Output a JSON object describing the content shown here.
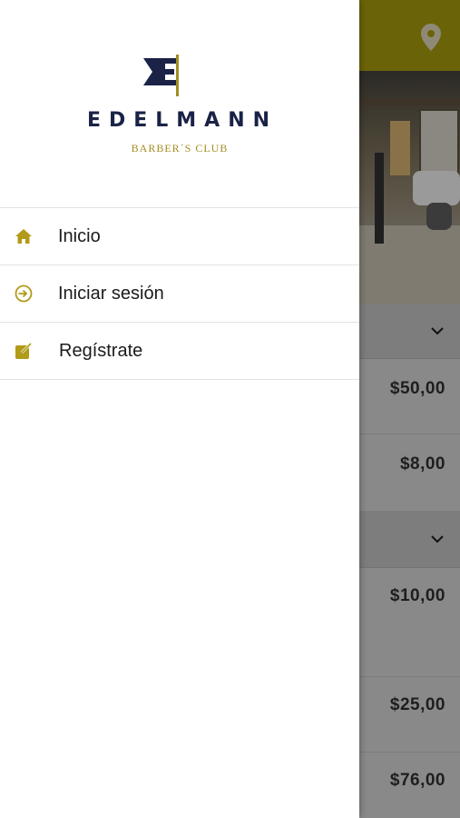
{
  "brand": {
    "name": "EDELMANN",
    "subtitle": "BARBER´S CLUB"
  },
  "drawer": {
    "items": [
      {
        "label": "Inicio",
        "icon": "home-icon"
      },
      {
        "label": "Iniciar sesión",
        "icon": "login-icon"
      },
      {
        "label": "Regístrate",
        "icon": "register-icon"
      }
    ]
  },
  "background": {
    "carousel": {
      "slides": 2,
      "active_index": 0
    },
    "prices": [
      "$50,00",
      "$8,00",
      "$10,00",
      "$25,00",
      "$76,00"
    ]
  },
  "colors": {
    "brand_navy": "#1a2346",
    "brand_gold": "#a38e22",
    "icon_gold": "#b19b18"
  }
}
